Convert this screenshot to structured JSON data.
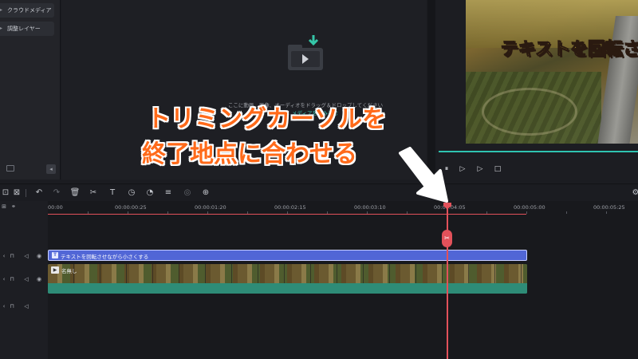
{
  "sidebar": {
    "items": [
      {
        "label": "クラウドメディア"
      },
      {
        "label": "調整レイヤー"
      }
    ]
  },
  "media": {
    "hint": "ここに動画、画像、オーディオをドラッグ＆ドロップしてください",
    "link": "メディアを読み込む"
  },
  "preview": {
    "caption": "テキストを回転さ",
    "controls": [
      "skip-back-icon",
      "play-frame-icon",
      "play-icon",
      "stop-icon"
    ]
  },
  "toolbar": {
    "icons": [
      "select-icon",
      "cut-select-icon",
      "undo-icon",
      "redo-icon",
      "delete-icon",
      "scissors-icon",
      "text-icon",
      "timer-icon",
      "speed-icon",
      "adjust-icon",
      "color-icon",
      "stabilize-icon"
    ]
  },
  "timeline": {
    "ruler": [
      "00:00",
      "00:00:00:25",
      "00:00:01:20",
      "00:00:02:15",
      "00:00:03:10",
      "00:00:04:05",
      "00:00:05:00",
      "00:00:05:25"
    ],
    "playhead_time": "00:00:04:05",
    "tracks": {
      "text_clip": "テキストを回転させながら小さくする",
      "video_clip": "名無し"
    }
  },
  "annotation": {
    "line1": "トリミングカーソルを",
    "line2": "終了地点に合わせる"
  },
  "colors": {
    "accent": "#2ec3b0",
    "playhead": "#e2515a",
    "text_clip": "#5166d6",
    "annotation": "#ff6a1a"
  }
}
